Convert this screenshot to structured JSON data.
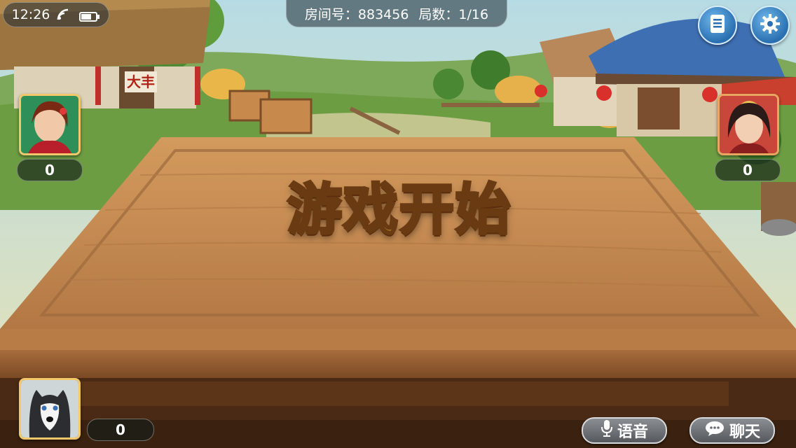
{
  "status_bar": {
    "time": "12:26"
  },
  "room_info": {
    "room_label": "房间号：883456",
    "round_label": "局数：1/16"
  },
  "banner": {
    "text": "游戏开始"
  },
  "shop_sign": {
    "text": "大丰"
  },
  "players": {
    "top_left": {
      "score": "0"
    },
    "top_right": {
      "score": "0"
    },
    "self": {
      "score": "0"
    }
  },
  "buttons": {
    "voice_label": "语音",
    "chat_label": "聊天"
  },
  "icons": {
    "wifi": "wifi-icon",
    "battery": "battery-icon",
    "menu": "document-icon",
    "settings": "gear-icon",
    "mic": "microphone-icon",
    "chat": "speech-bubble-icon"
  },
  "colors": {
    "table": "#c48a52",
    "banner_text": "#ffd54a",
    "button_blue": "#2a6fb0"
  }
}
